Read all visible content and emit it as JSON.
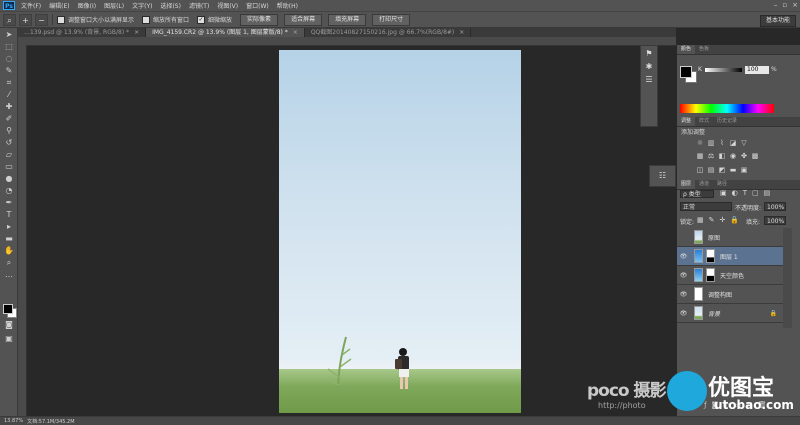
{
  "app": {
    "logo": "Ps"
  },
  "menubar": {
    "items": [
      "文件(F)",
      "编辑(E)",
      "图像(I)",
      "图层(L)",
      "文字(Y)",
      "选择(S)",
      "滤镜(T)",
      "视图(V)",
      "窗口(W)",
      "帮助(H)"
    ],
    "window_controls": [
      "–",
      "▫",
      "×"
    ]
  },
  "optionsbar": {
    "zoom_tool_icon": "zoom-icon",
    "check_resize": "调整窗口大小以满屏显示",
    "check_zoom_all": "缩放所有窗口",
    "check_scrubby": "细微缩放",
    "btn_actual": "实际像素",
    "btn_fit": "适合屏幕",
    "btn_fill": "填充屏幕",
    "btn_print": "打印尺寸",
    "workspace": "基本功能"
  },
  "tabs": [
    {
      "label": "…139.psd @ 13.9% (背景, RGB/8) *",
      "active": false
    },
    {
      "label": "IMG_4159.CR2 @ 13.9% (图层 1, 图层蒙版/8) *",
      "active": true
    },
    {
      "label": "QQ截图20140827150216.jpg @ 66.7%(RGB/8#)",
      "active": false
    }
  ],
  "panels": {
    "color_tabs": [
      "颜色",
      "色板"
    ],
    "color": {
      "channel": "K",
      "value": "100",
      "unit": "%"
    },
    "adjust_tabs": [
      "调整",
      "样式",
      "历史记录"
    ],
    "adjust_title": "添加调整",
    "layers_tabs": [
      "图层",
      "通道",
      "路径"
    ],
    "filter": "ρ 类型",
    "blend_mode": "正常",
    "opacity_label": "不透明度:",
    "opacity_value": "100%",
    "lock_label": "锁定:",
    "fill_label": "填充:",
    "fill_value": "100%"
  },
  "layers": [
    {
      "name": "原图",
      "visible": false,
      "selected": false,
      "lock": ""
    },
    {
      "name": "图层 1",
      "visible": true,
      "selected": true,
      "lock": ""
    },
    {
      "name": "天空颜色",
      "visible": true,
      "selected": false,
      "lock": ""
    },
    {
      "name": "调整构图",
      "visible": true,
      "selected": false,
      "lock": ""
    },
    {
      "name": "背景",
      "visible": true,
      "selected": false,
      "lock": "🔒"
    }
  ],
  "statusbar": {
    "zoom": "13.87%",
    "doc": "文档:57.1M/345.2M"
  },
  "watermark": {
    "poco": "poco 摄影",
    "photo": "http://photo",
    "cn": "优图宝",
    "url": "utobao.com"
  },
  "colors": {
    "accent": "#31a8ff",
    "selected_layer": "#5c7291",
    "bg": "#282828",
    "panel": "#535353"
  }
}
